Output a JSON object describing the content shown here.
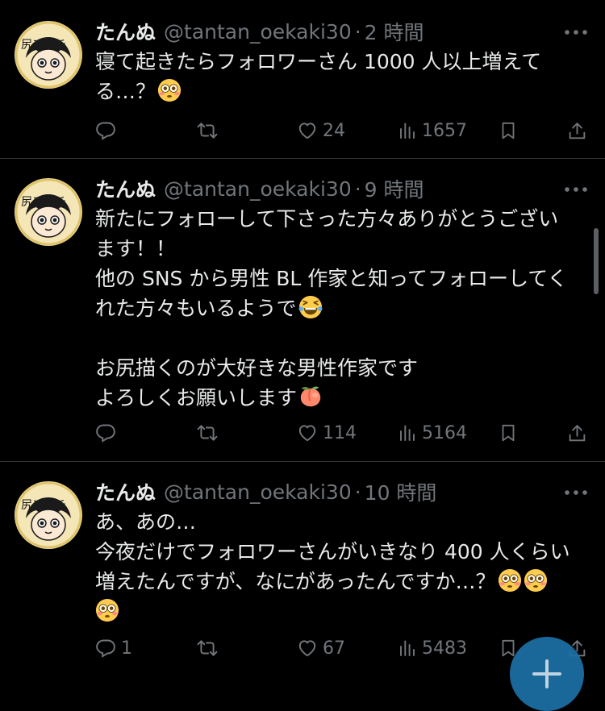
{
  "tweets": [
    {
      "name": "たんぬ",
      "handle": "@tantan_oekaki30",
      "time": "2 時間",
      "lines": [
        "寝て起きたらフォロワーさん 1000 人以上増えて",
        "る…？"
      ],
      "emoji_line": 1,
      "emojis": [
        "flushed-face"
      ],
      "reply_count": "",
      "like_count": "24",
      "view_count": "1657"
    },
    {
      "name": "たんぬ",
      "handle": "@tantan_oekaki30",
      "time": "9 時間",
      "lines": [
        "新たにフォローして下さった方々ありがとうござい",
        "ます！！",
        "他の SNS から男性 BL 作家と知ってフォローしてく",
        "れた方々もいるようで",
        "",
        "お尻描くのが大好きな男性作家です",
        "よろしくお願いします"
      ],
      "emoji_line_a": 3,
      "emoji_a": "laughing-tears-face",
      "emoji_line_b": 6,
      "emoji_b": "peach",
      "reply_count": "",
      "like_count": "114",
      "view_count": "5164"
    },
    {
      "name": "たんぬ",
      "handle": "@tantan_oekaki30",
      "time": "10 時間",
      "lines": [
        "あ、あの…",
        "今夜だけでフォロワーさんがいきなり 400 人くらい",
        "増えたんですが、なにがあったんですか…？"
      ],
      "emojis": [
        "flushed-face",
        "flushed-face",
        "flushed-face"
      ],
      "reply_count": "1",
      "like_count": "67",
      "view_count": "5483"
    }
  ],
  "avatar_text": "尻フェチ",
  "colors": {
    "background": "#000000",
    "text": "#e7e9ea",
    "muted": "#71767b",
    "divider": "#2f3336",
    "fab": "#1d6fa5"
  },
  "icons": [
    "reply-icon",
    "retweet-icon",
    "heart-icon",
    "views-icon",
    "bookmark-icon",
    "share-icon",
    "more-icon",
    "compose-plus-icon"
  ]
}
